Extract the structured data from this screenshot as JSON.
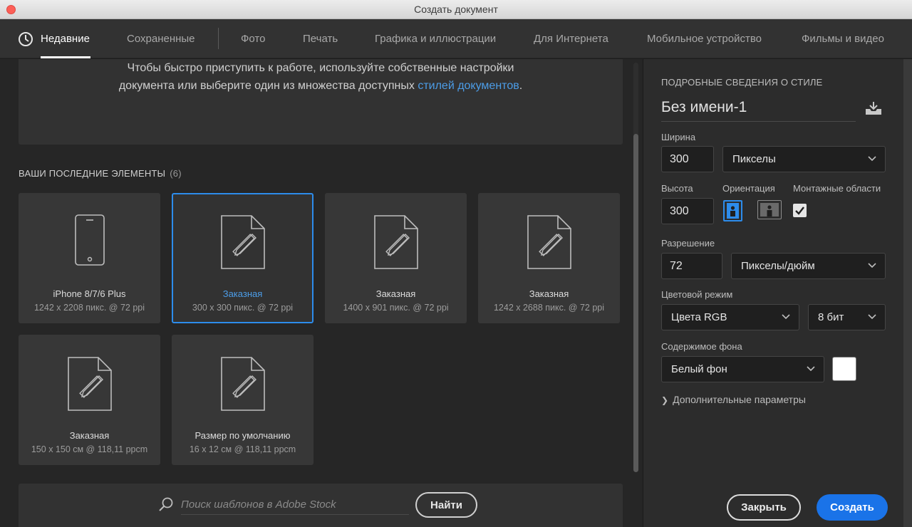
{
  "window": {
    "title": "Создать документ"
  },
  "tabs": [
    {
      "label": "Недавние",
      "active": true
    },
    {
      "label": "Сохраненные"
    },
    {
      "label": "Фото"
    },
    {
      "label": "Печать"
    },
    {
      "label": "Графика и иллюстрации"
    },
    {
      "label": "Для Интернета"
    },
    {
      "label": "Мобильное устройство"
    },
    {
      "label": "Фильмы и видео"
    }
  ],
  "intro": {
    "text": "Чтобы быстро приступить к работе, используйте собственные настройки документа или выберите один из множества доступных ",
    "link": "стилей документов",
    "tail": "."
  },
  "recent": {
    "title": "ВАШИ ПОСЛЕДНИЕ ЭЛЕМЕНТЫ",
    "count": "(6)",
    "items": [
      {
        "name": "iPhone 8/7/6 Plus",
        "meta": "1242 x 2208 пикс. @ 72 ppi",
        "icon": "phone-icon"
      },
      {
        "name": "Заказная",
        "meta": "300 x 300 пикс. @ 72 ppi",
        "icon": "custom-document-icon",
        "selected": true
      },
      {
        "name": "Заказная",
        "meta": "1400 x 901 пикс. @ 72 ppi",
        "icon": "custom-document-icon"
      },
      {
        "name": "Заказная",
        "meta": "1242 x 2688 пикс. @ 72 ppi",
        "icon": "custom-document-icon"
      },
      {
        "name": "Заказная",
        "meta": "150 x 150 см @ 118,11 ppcm",
        "icon": "custom-document-icon"
      },
      {
        "name": "Размер по умолчанию",
        "meta": "16 x 12 см @ 118,11 ppcm",
        "icon": "custom-document-icon"
      }
    ]
  },
  "search": {
    "placeholder": "Поиск шаблонов в Adobe Stock",
    "button": "Найти"
  },
  "details": {
    "heading": "ПОДРОБНЫЕ СВЕДЕНИЯ О СТИЛЕ",
    "doc_name": "Без имени-1",
    "width_label": "Ширина",
    "width_value": "300",
    "width_unit": "Пикселы",
    "height_label": "Высота",
    "height_value": "300",
    "orientation_label": "Ориентация",
    "orientation": "portrait",
    "artboards_label": "Монтажные области",
    "artboards_checked": true,
    "resolution_label": "Разрешение",
    "resolution_value": "72",
    "resolution_unit": "Пикселы/дюйм",
    "color_mode_label": "Цветовой режим",
    "color_mode": "Цвета RGB",
    "bit_depth": "8 бит",
    "background_label": "Содержимое фона",
    "background": "Белый фон",
    "background_color": "#ffffff",
    "advanced": "Дополнительные параметры"
  },
  "actions": {
    "close": "Закрыть",
    "create": "Создать"
  },
  "colors": {
    "accent": "#2d8ceb",
    "link": "#4c9de8",
    "primary_button": "#1a73e8"
  }
}
